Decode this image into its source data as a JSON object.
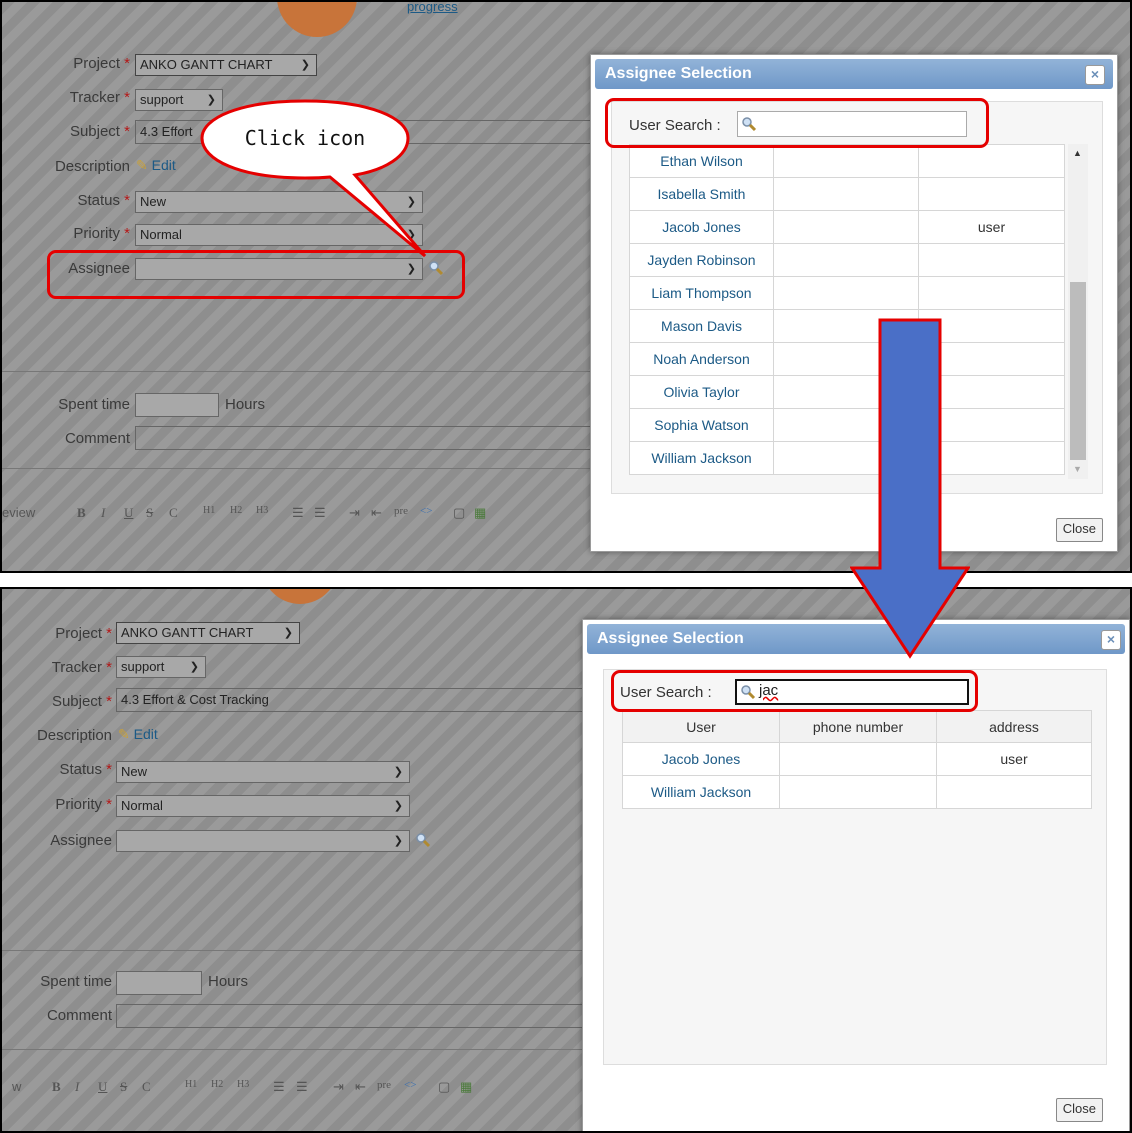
{
  "form": {
    "project_label": "Project",
    "project_value": "ANKO GANTT CHART",
    "tracker_label": "Tracker",
    "tracker_value": "support",
    "subject_label": "Subject",
    "subject_value": "4.3 Effort & Cost Tracking",
    "subject_value_top": "4.3 Effort",
    "description_label": "Description",
    "edit_label": "Edit",
    "status_label": "Status",
    "status_value": "New",
    "priority_label": "Priority",
    "priority_value": "Normal",
    "assignee_label": "Assignee",
    "assignee_value": "",
    "spent_time_label": "Spent time",
    "hours_label": "Hours",
    "comment_label": "Comment",
    "required_mark": "*",
    "progress_text": "progress",
    "preview_partial_top": "eview",
    "preview_partial_bottom": "w"
  },
  "toolbar": [
    "B",
    "I",
    "U",
    "S",
    "C",
    "H1",
    "H2",
    "H3",
    "pre",
    "<>"
  ],
  "callout": {
    "text": "Click icon"
  },
  "dialog": {
    "title": "Assignee Selection",
    "close_x": "×",
    "search_label": "User Search :",
    "search_value_top": "",
    "search_value_bottom": "jac",
    "close_label": "Close",
    "columns": [
      "User",
      "phone number",
      "address"
    ],
    "rows_top": [
      {
        "user": "Ethan Wilson",
        "phone": "",
        "address": ""
      },
      {
        "user": "Isabella Smith",
        "phone": "",
        "address": ""
      },
      {
        "user": "Jacob Jones",
        "phone": "",
        "address": "user"
      },
      {
        "user": "Jayden Robinson",
        "phone": "",
        "address": ""
      },
      {
        "user": "Liam Thompson",
        "phone": "",
        "address": ""
      },
      {
        "user": "Mason Davis",
        "phone": "",
        "address": ""
      },
      {
        "user": "Noah Anderson",
        "phone": "",
        "address": ""
      },
      {
        "user": "Olivia Taylor",
        "phone": "",
        "address": ""
      },
      {
        "user": "Sophia Watson",
        "phone": "",
        "address": ""
      },
      {
        "user": "William Jackson",
        "phone": "",
        "address": ""
      }
    ],
    "rows_bottom": [
      {
        "user": "Jacob Jones",
        "phone": "",
        "address": "user"
      },
      {
        "user": "William Jackson",
        "phone": "",
        "address": ""
      }
    ]
  },
  "colors": {
    "highlight": "#e50000",
    "arrow": "#4a6fc7",
    "link": "#1c5a86",
    "dialog_header": "#7ea3cf"
  }
}
